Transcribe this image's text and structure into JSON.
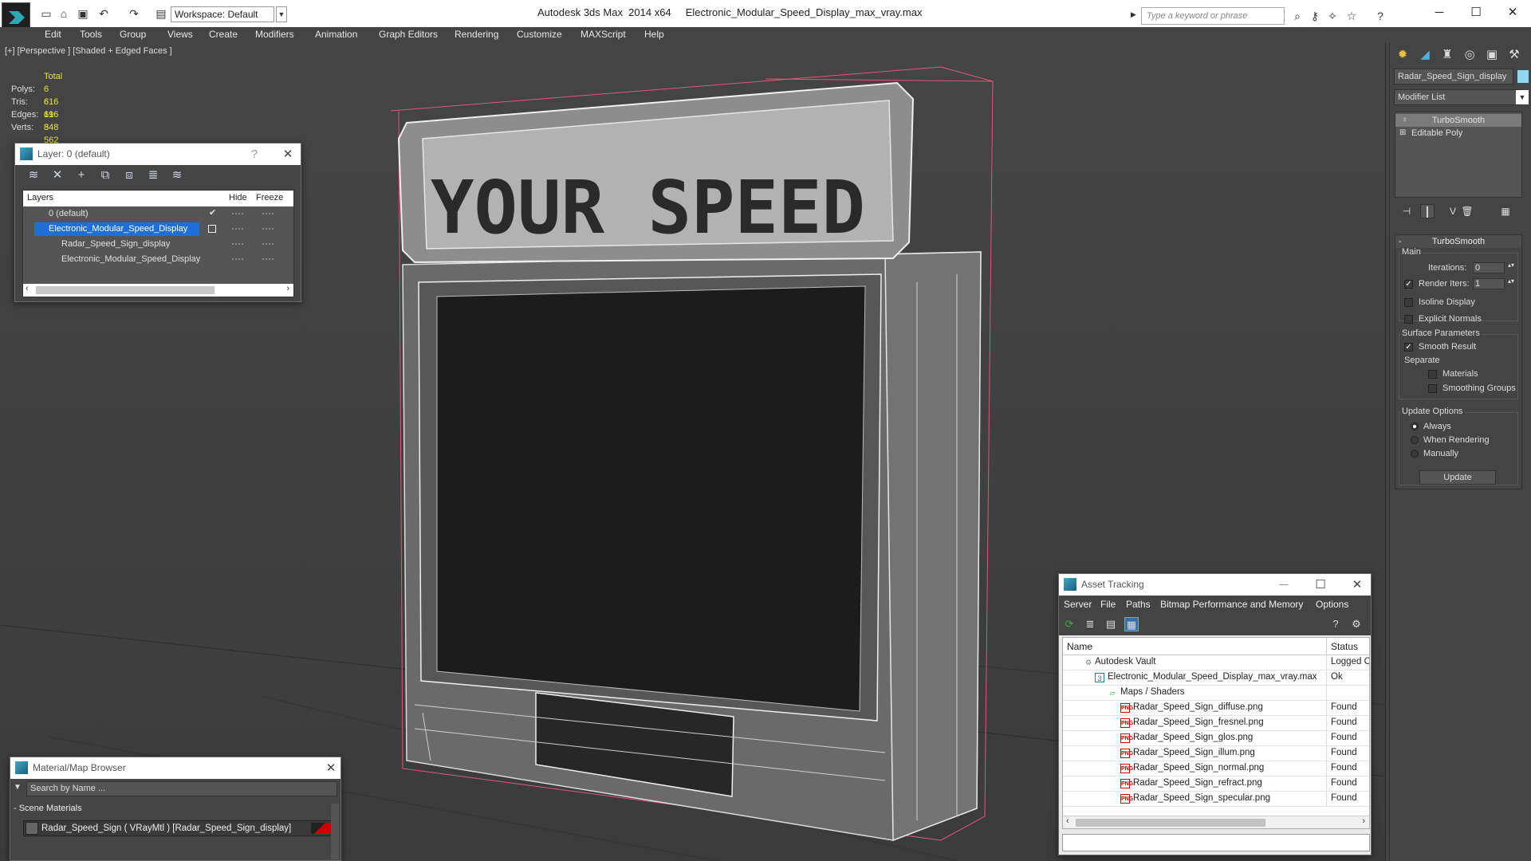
{
  "window": {
    "app_title": "Autodesk 3ds Max  2014 x64",
    "file_title": "Electronic_Modular_Speed_Display_max_vray.max",
    "workspace": "Workspace: Default",
    "search_placeholder": "Type a keyword or phrase"
  },
  "menu": [
    "Edit",
    "Tools",
    "Group",
    "Views",
    "Create",
    "Modifiers",
    "Animation",
    "Graph Editors",
    "Rendering",
    "Customize",
    "MAXScript",
    "Help"
  ],
  "viewport": {
    "label": "[+] [Perspective ] [Shaded + Edged Faces ]",
    "stats": {
      "total_label": "Total",
      "polys_label": "Polys:",
      "polys": "6 616",
      "tris_label": "Tris:",
      "tris": "6 616",
      "edges_label": "Edges:",
      "edges": "19 848",
      "verts_label": "Verts:",
      "verts": "3 562"
    },
    "sign_text": "YOUR SPEED"
  },
  "layer_window": {
    "title": "Layer: 0 (default)",
    "help": "?",
    "columns": [
      "Layers",
      "Hide",
      "Freeze"
    ],
    "rows": [
      {
        "name": "0 (default)"
      },
      {
        "name": "Electronic_Modular_Speed_Display"
      },
      {
        "name": "Radar_Speed_Sign_display"
      },
      {
        "name": "Electronic_Modular_Speed_Display"
      }
    ]
  },
  "command_panel": {
    "object_name": "Radar_Speed_Sign_display",
    "object_color": "#8fd8f0",
    "modifier_list": "Modifier List",
    "stack": [
      "TurboSmooth",
      "Editable Poly"
    ],
    "rollout_title": "TurboSmooth",
    "main_label": "Main",
    "iterations_label": "Iterations:",
    "iterations_value": "0",
    "render_iters_label": "Render Iters:",
    "render_iters_value": "1",
    "isoline_label": "Isoline Display",
    "explicit_normals_label": "Explicit Normals",
    "surface_params_label": "Surface Parameters",
    "smooth_result_label": "Smooth Result",
    "separate_label": "Separate",
    "materials_label": "Materials",
    "smoothing_groups_label": "Smoothing Groups",
    "update_options_label": "Update Options",
    "always_label": "Always",
    "when_rendering_label": "When Rendering",
    "manually_label": "Manually",
    "update_button": "Update"
  },
  "asset_tracking": {
    "title": "Asset Tracking",
    "menu": [
      "Server",
      "File",
      "Paths",
      "Bitmap Performance and Memory",
      "Options"
    ],
    "columns": [
      "Name",
      "Status"
    ],
    "rows": [
      {
        "name": "Autodesk Vault",
        "status": "Logged O"
      },
      {
        "name": "Electronic_Modular_Speed_Display_max_vray.max",
        "status": "Ok"
      },
      {
        "name": "Maps / Shaders",
        "status": ""
      },
      {
        "name": "Radar_Speed_Sign_diffuse.png",
        "status": "Found"
      },
      {
        "name": "Radar_Speed_Sign_fresnel.png",
        "status": "Found"
      },
      {
        "name": "Radar_Speed_Sign_glos.png",
        "status": "Found"
      },
      {
        "name": "Radar_Speed_Sign_illum.png",
        "status": "Found"
      },
      {
        "name": "Radar_Speed_Sign_normal.png",
        "status": "Found"
      },
      {
        "name": "Radar_Speed_Sign_refract.png",
        "status": "Found"
      },
      {
        "name": "Radar_Speed_Sign_specular.png",
        "status": "Found"
      }
    ]
  },
  "material_browser": {
    "title": "Material/Map Browser",
    "search_placeholder": "Search by Name ...",
    "section": "- Scene Materials",
    "item": "Radar_Speed_Sign ( VRayMtl ) [Radar_Speed_Sign_display]"
  }
}
